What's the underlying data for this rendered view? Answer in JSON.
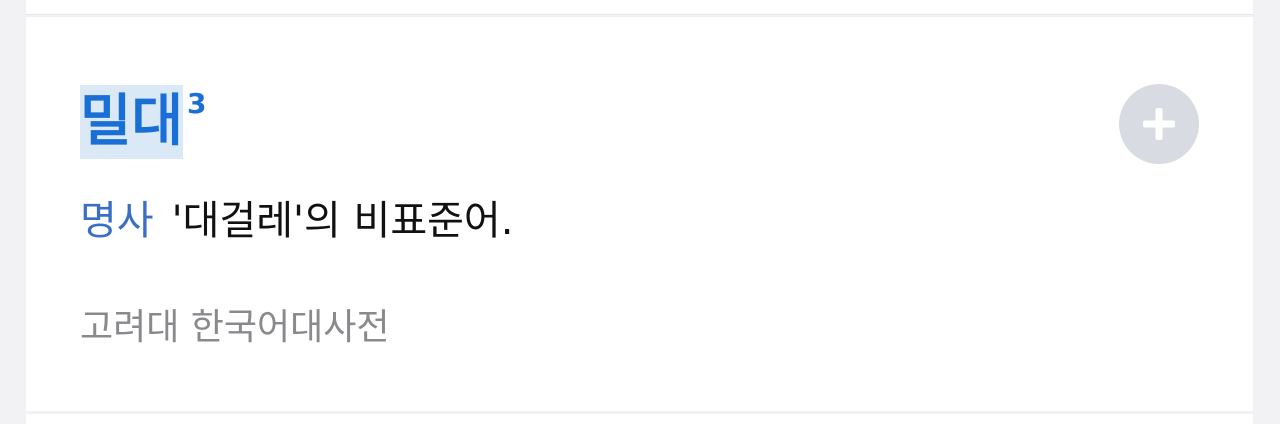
{
  "entry": {
    "headword": "밀대",
    "homonym_number": "3",
    "part_of_speech": "명사",
    "definition": "'대걸레'의 비표준어.",
    "source": "고려대 한국어대사전",
    "add_button_icon": "plus-icon"
  },
  "colors": {
    "headword": "#1a6fd6",
    "headword_highlight": "#dbe9f7",
    "part_of_speech": "#3a6ec7",
    "source": "#8a8a8e",
    "add_button_bg": "#d8dbe1"
  }
}
